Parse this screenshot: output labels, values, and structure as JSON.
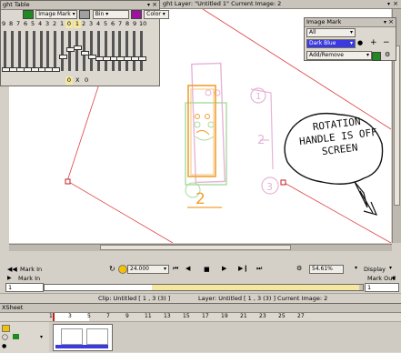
{
  "light_table": {
    "title": "ght Table",
    "image_mark_label": "Image Mark",
    "bin_label": "Bin",
    "color_label": "Color",
    "numbers": [
      "9",
      "8",
      "7",
      "6",
      "5",
      "4",
      "3",
      "2",
      "1",
      "0",
      "1",
      "2",
      "3",
      "4",
      "5",
      "6",
      "7",
      "8",
      "9",
      "10"
    ],
    "readout_left": "0",
    "readout_x": "X",
    "readout_right": "0",
    "slider_levels": [
      0.0,
      0.0,
      0.0,
      0.0,
      0.0,
      0.0,
      0.0,
      0.0,
      0.35,
      0.55,
      0.6,
      0.45,
      0.35,
      0.3,
      0.3,
      0.3,
      0.3,
      0.3,
      0.3,
      0.3
    ],
    "colors": {
      "green": "#1f8a1f",
      "magenta": "#a010a0",
      "highlight": "#f5e6a0"
    }
  },
  "canvas": {
    "title": "ght Layer: \"Untitled 1\"  Current Image: 2",
    "annotation_text": "ROTATION HANDLE IS OFF SCREEN",
    "drawing_number": "2",
    "circled_labels": [
      "1",
      "2",
      "3"
    ]
  },
  "image_mark": {
    "title": "Image Mark",
    "all_label": "All",
    "dark_blue_label": "Dark Blue",
    "add_remove_label": "Add/Remove",
    "colors": {
      "dark_blue": "#3a3ae0"
    }
  },
  "transport": {
    "zoom": "54.61%",
    "display_label": "Display",
    "fps": "24.000",
    "mark_in_label": "Mark In",
    "mark_out_label": "Mark Out",
    "mark_in_value": "1",
    "mark_out_value": "1",
    "status_left": "Clip: Untitled [ 1 , 3  (3) ]",
    "status_right": "Layer: Untitled [ 1 , 3  (3) ]   Current Image: 2"
  },
  "xsheet": {
    "title": "XSheet",
    "frame_numbers": [
      "1",
      "3",
      "5",
      "7",
      "9",
      "11",
      "13",
      "15",
      "17",
      "19",
      "21",
      "23",
      "25",
      "27"
    ]
  }
}
